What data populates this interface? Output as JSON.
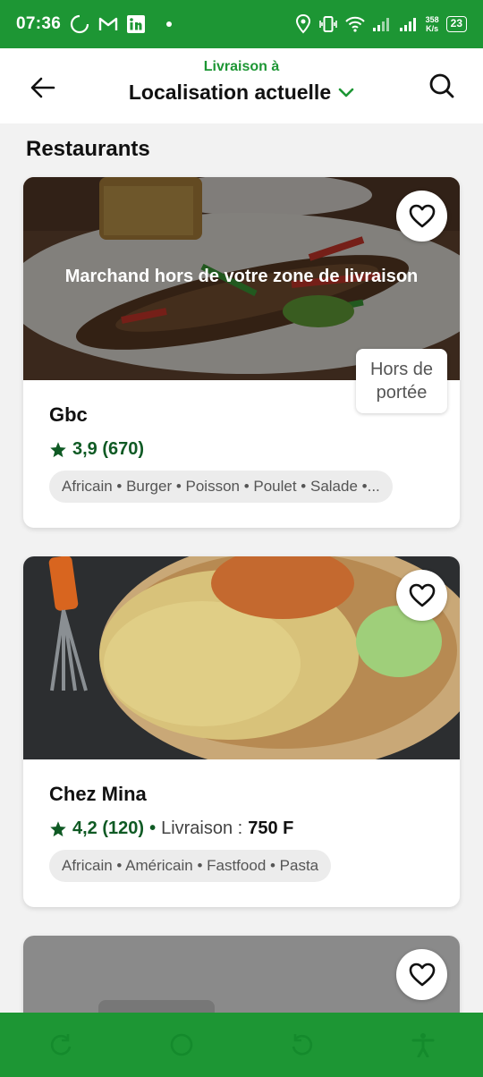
{
  "status_bar": {
    "time": "07:36",
    "speed_value": "358",
    "speed_unit": "K/s",
    "battery": "23"
  },
  "header": {
    "delivery_label": "Livraison à",
    "location": "Localisation actuelle"
  },
  "section_title": "Restaurants",
  "restaurants": [
    {
      "name": "Gbc",
      "rating": "3,9 (670)",
      "overlay": "Marchand hors de votre zone de livraison",
      "badge_line1": "Hors de",
      "badge_line2": "portée",
      "tags": "Africain • Burger • Poisson • Poulet • Salade •..."
    },
    {
      "name": "Chez Mina",
      "rating": "4,2 (120)",
      "separator": "•",
      "delivery_label": "Livraison :",
      "delivery_fee": "750 F",
      "tags": "Africain • Américain • Fastfood • Pasta"
    },
    {
      "name": ""
    }
  ],
  "colors": {
    "brand_green": "#1d9634",
    "rating_green": "#0f5a24"
  },
  "icons": [
    "back-arrow-icon",
    "search-icon",
    "chevron-down-icon",
    "heart-icon",
    "star-icon"
  ]
}
